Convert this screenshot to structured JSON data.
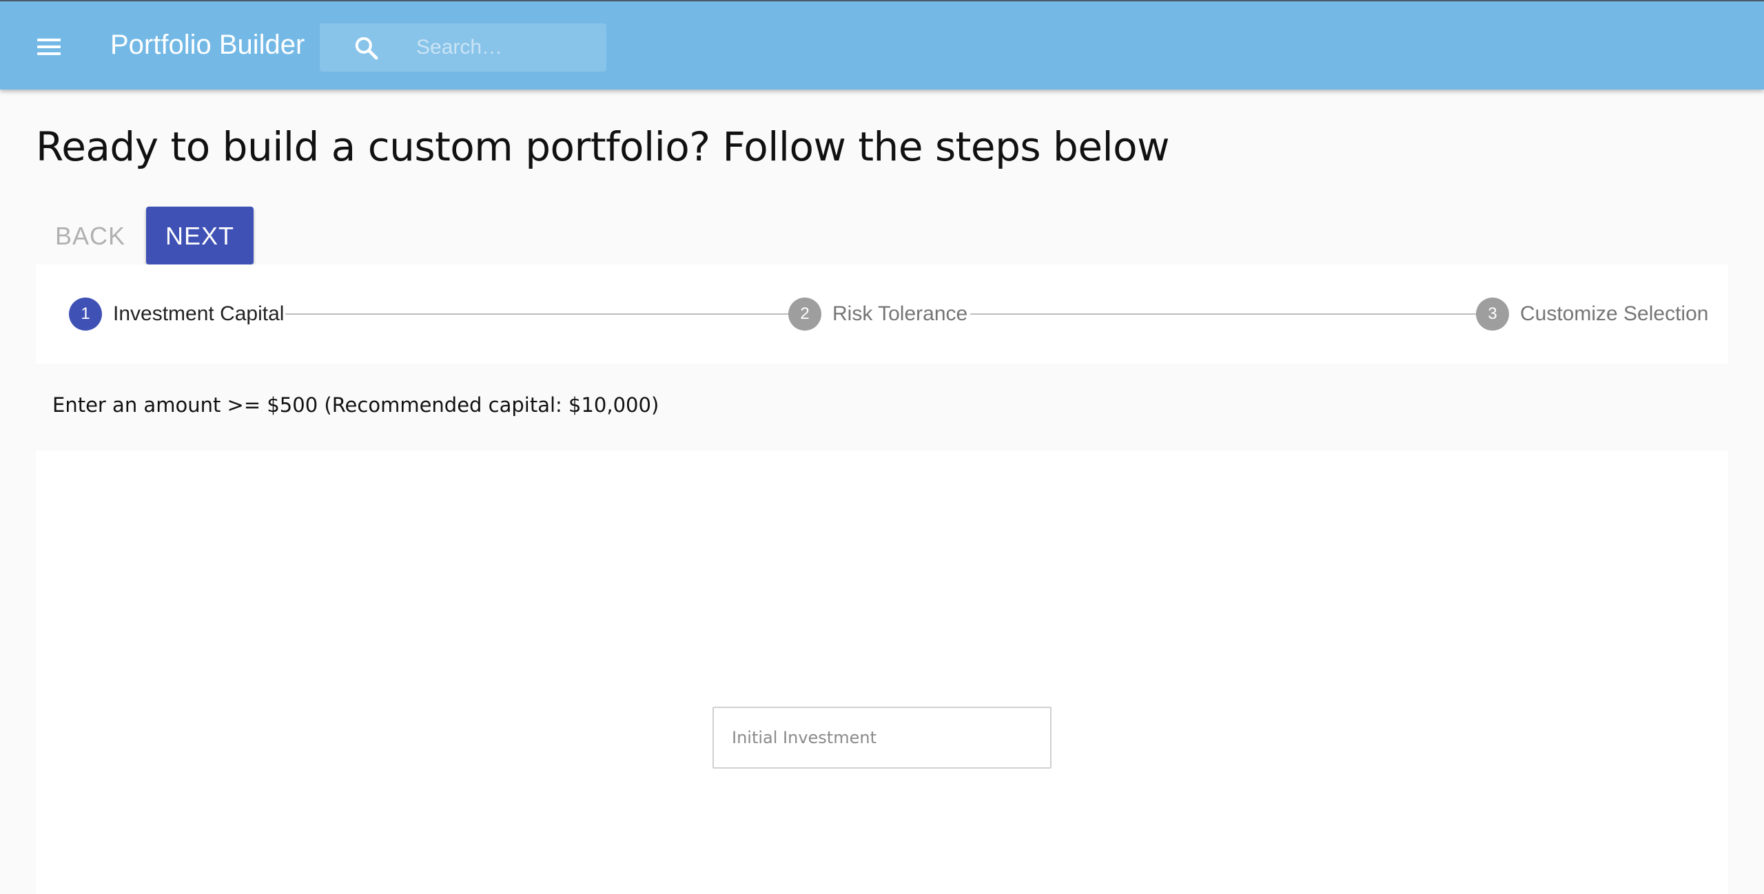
{
  "appbar": {
    "title": "Portfolio Builder",
    "menu_icon": "menu-icon",
    "search": {
      "icon": "search-icon",
      "placeholder": "Search…",
      "value": ""
    },
    "color": "#74b9e6"
  },
  "page": {
    "heading": "Ready to build a custom portfolio? Follow the steps below"
  },
  "actions": {
    "back_label": "BACK",
    "next_label": "NEXT",
    "back_enabled": false,
    "next_color": "#3f51b5"
  },
  "stepper": {
    "steps": [
      {
        "number": "1",
        "label": "Investment Capital",
        "state": "active"
      },
      {
        "number": "2",
        "label": "Risk Tolerance",
        "state": "inactive"
      },
      {
        "number": "3",
        "label": "Customize Selection",
        "state": "inactive"
      }
    ],
    "active_color": "#3f51b5",
    "inactive_color": "#9e9e9e"
  },
  "step1": {
    "instruction": "Enter an amount >= $500 (Recommended capital: $10,000)",
    "input": {
      "placeholder": "Initial Investment",
      "value": ""
    }
  }
}
